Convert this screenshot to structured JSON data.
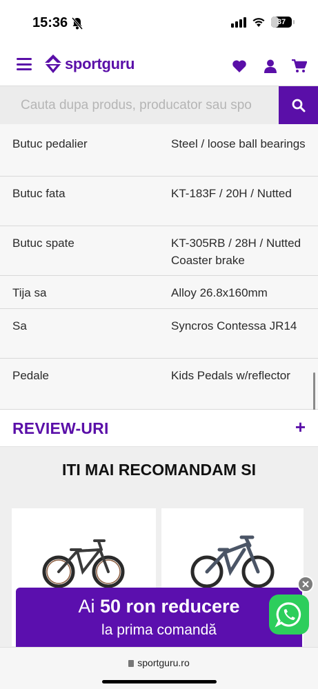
{
  "status_bar": {
    "time": "15:36",
    "battery": "37",
    "battery_level": 0.37
  },
  "header": {
    "brand": "sportguru"
  },
  "search": {
    "placeholder": "Cauta dupa produs, producator sau spo"
  },
  "specs": [
    {
      "key": "Butuc pedalier",
      "value": "Steel / loose ball bearings"
    },
    {
      "key": "Butuc fata",
      "value": "KT-183F / 20H / Nutted"
    },
    {
      "key": "Butuc spate",
      "value": "KT-305RB / 28H / Nutted Coaster brake"
    },
    {
      "key": "Tija sa",
      "value": "Alloy 26.8x160mm"
    },
    {
      "key": "Sa",
      "value": "Syncros Contessa JR14"
    },
    {
      "key": "Pedale",
      "value": "Kids Pedals w/reflector"
    }
  ],
  "reviews": {
    "title": "REVIEW-URI",
    "toggle": "+"
  },
  "recommendations": {
    "title": "ITI MAI RECOMANDAM SI"
  },
  "promo": {
    "prefix": "Ai",
    "amount": "50 ron reducere",
    "line2": "la prima comandă"
  },
  "browser": {
    "url": "sportguru.ro"
  },
  "colors": {
    "brand": "#5a0fa8",
    "whatsapp": "#2dce5c"
  }
}
